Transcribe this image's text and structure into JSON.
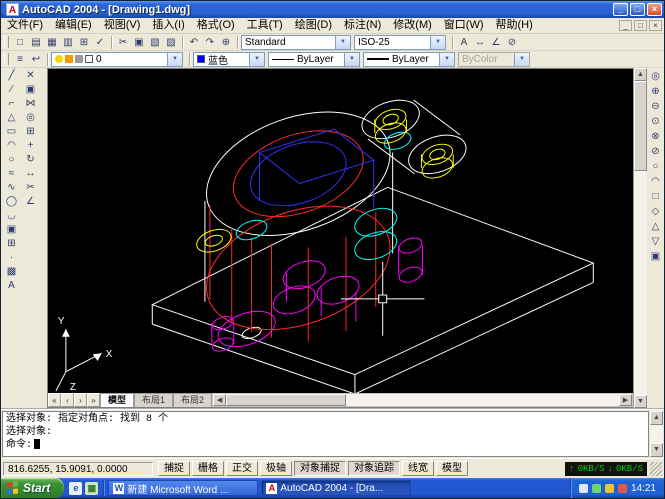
{
  "window": {
    "title": "AutoCAD 2004 - [Drawing1.dwg]",
    "icon_letter": "A",
    "controls": {
      "minimize": "_",
      "maximize": "□",
      "close": "×"
    }
  },
  "menubar": {
    "items": [
      "文件(F)",
      "编辑(E)",
      "视图(V)",
      "插入(I)",
      "格式(O)",
      "工具(T)",
      "绘图(D)",
      "标注(N)",
      "修改(M)",
      "窗口(W)",
      "帮助(H)"
    ],
    "controls": {
      "minimize": "_",
      "restore": "□",
      "close": "×"
    }
  },
  "toolbar1": {
    "text_style": "Standard",
    "dim_style": "ISO-25"
  },
  "toolbar2": {
    "layer_name": "0",
    "color_name": "蓝色",
    "linetype": "ByLayer",
    "lineweight": "ByLayer",
    "plot_style": "ByColor"
  },
  "icons": {
    "standard": [
      "□",
      "▤",
      "▦",
      "▥",
      "⊞",
      "✓",
      "✂",
      "▣",
      "▧",
      "▨",
      "↶",
      "↷",
      "⊕"
    ],
    "standard_right": [
      "A",
      "↔",
      "∠",
      "⊘"
    ],
    "layers_left": [
      "≡",
      "↩"
    ],
    "draw": [
      "╱",
      "∕",
      "⌐",
      "△",
      "▭",
      "◠",
      "○",
      "≈",
      "∿",
      "◯",
      "◡",
      "▣",
      "⊞",
      "·",
      "▩",
      "A"
    ],
    "modify": [
      "✕",
      "▣",
      "⋈",
      "◎",
      "⊞",
      "+",
      "↻",
      "↔",
      "✂",
      "∠"
    ],
    "view": [
      "◎",
      "⊕",
      "⊖",
      "⊙",
      "⊗",
      "⊘",
      "○",
      "◠",
      "□",
      "◇",
      "△",
      "▽",
      "▣"
    ],
    "tab_nav": [
      "«",
      "‹",
      "›",
      "»"
    ],
    "arrow_up": "▲",
    "arrow_down": "▼",
    "arrow_left": "◀",
    "arrow_right": "▶",
    "combo_arrow": "▼",
    "net_up_arrow": "↑",
    "net_down_arrow": "↓"
  },
  "layout_tabs": {
    "tabs": [
      "模型",
      "布局1",
      "布局2"
    ],
    "active": "模型"
  },
  "command": {
    "lines": [
      "选择对象: 指定对角点: 找到 8 个",
      "选择对象:"
    ],
    "prompt": "命令:"
  },
  "statusbar": {
    "coords": "816.6255, 15.9091, 0.0000",
    "toggles": [
      "捕捉",
      "栅格",
      "正交",
      "极轴",
      "对象捕捉",
      "对象追踪",
      "线宽",
      "模型"
    ],
    "net_up": "0KB/S",
    "net_down": "0KB/S"
  },
  "taskbar": {
    "start_label": "Start",
    "tasks": [
      {
        "icon": "W",
        "label": "新建 Microsoft Word ..."
      },
      {
        "icon": "A",
        "label": "AutoCAD 2004 - [Dra..."
      }
    ],
    "time": "14:21"
  },
  "ucs": {
    "x": "X",
    "y": "Y",
    "z": "Z"
  },
  "palette": {
    "canvas_bg": "#000000",
    "wire_white": "#ffffff",
    "wire_red": "#ff2a2a",
    "wire_magenta": "#ff00ff",
    "wire_cyan": "#00ffff",
    "wire_yellow": "#ffff00",
    "wire_blue": "#3232ff",
    "color_swatch_blue": "#0000ff",
    "chrome": "#ece9d8",
    "titlebar_blue": "#2a63d4",
    "start_green": "#3b9334"
  }
}
